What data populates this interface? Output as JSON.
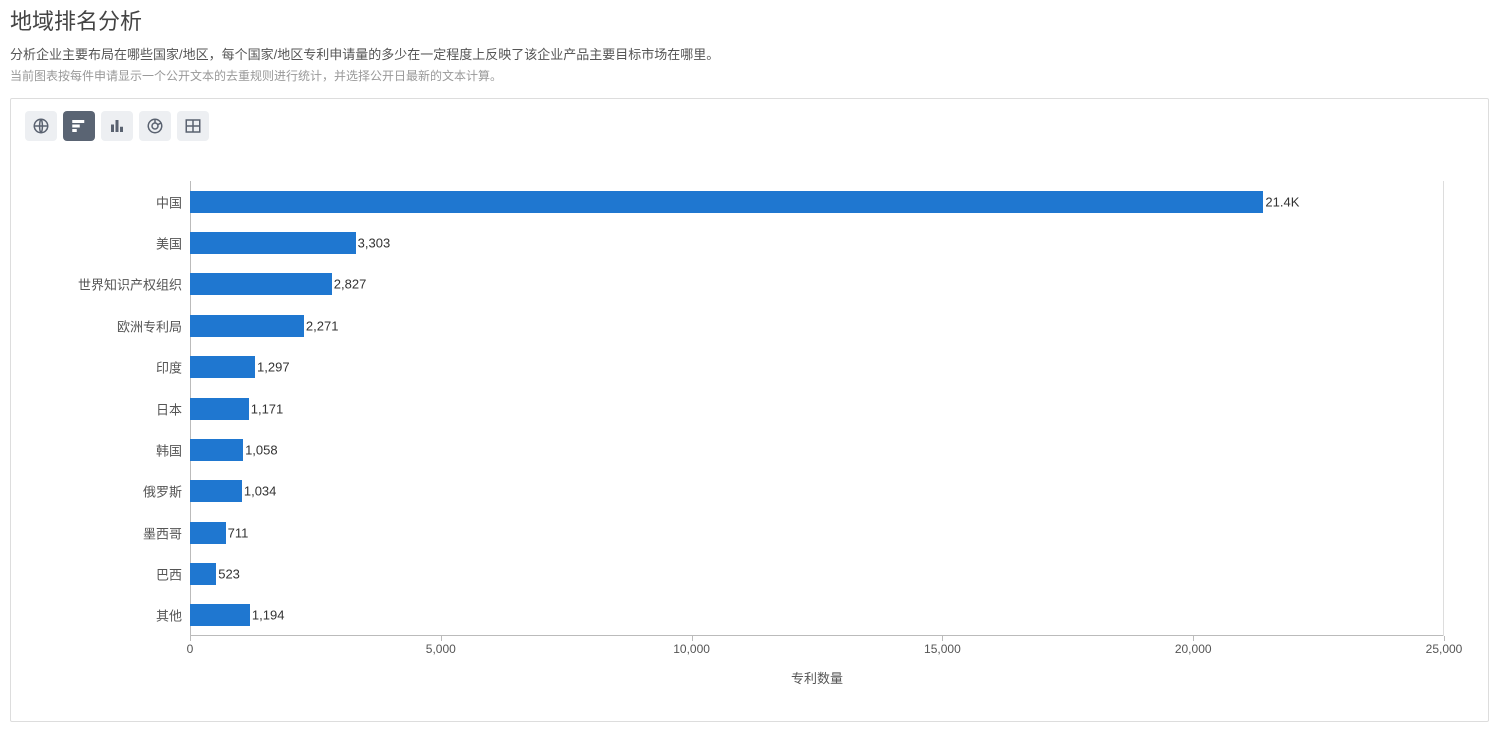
{
  "title": "地域排名分析",
  "subtitle": "分析企业主要布局在哪些国家/地区，每个国家/地区专利申请量的多少在一定程度上反映了该企业产品主要目标市场在哪里。",
  "subnote": "当前图表按每件申请显示一个公开文本的去重规则进行统计，并选择公开日最新的文本计算。",
  "toolbar": {
    "items": [
      {
        "name": "globe-icon",
        "active": false
      },
      {
        "name": "hbar-icon",
        "active": true
      },
      {
        "name": "vbar-icon",
        "active": false
      },
      {
        "name": "pie-icon",
        "active": false
      },
      {
        "name": "table-icon",
        "active": false
      }
    ]
  },
  "chart_data": {
    "type": "bar",
    "orientation": "horizontal",
    "xlabel": "专利数量",
    "ylabel": "",
    "xlim": [
      0,
      25000
    ],
    "xticks": [
      0,
      5000,
      10000,
      15000,
      20000,
      25000
    ],
    "xtick_labels": [
      "0",
      "5,000",
      "10,000",
      "15,000",
      "20,000",
      "25,000"
    ],
    "categories": [
      "中国",
      "美国",
      "世界知识产权组织",
      "欧洲专利局",
      "印度",
      "日本",
      "韩国",
      "俄罗斯",
      "墨西哥",
      "巴西",
      "其他"
    ],
    "values": [
      21400,
      3303,
      2827,
      2271,
      1297,
      1171,
      1058,
      1034,
      711,
      523,
      1194
    ],
    "value_labels": [
      "21.4K",
      "3,303",
      "2,827",
      "2,271",
      "1,297",
      "1,171",
      "1,058",
      "1,034",
      "711",
      "523",
      "1,194"
    ],
    "bar_color": "#1f77d0"
  }
}
